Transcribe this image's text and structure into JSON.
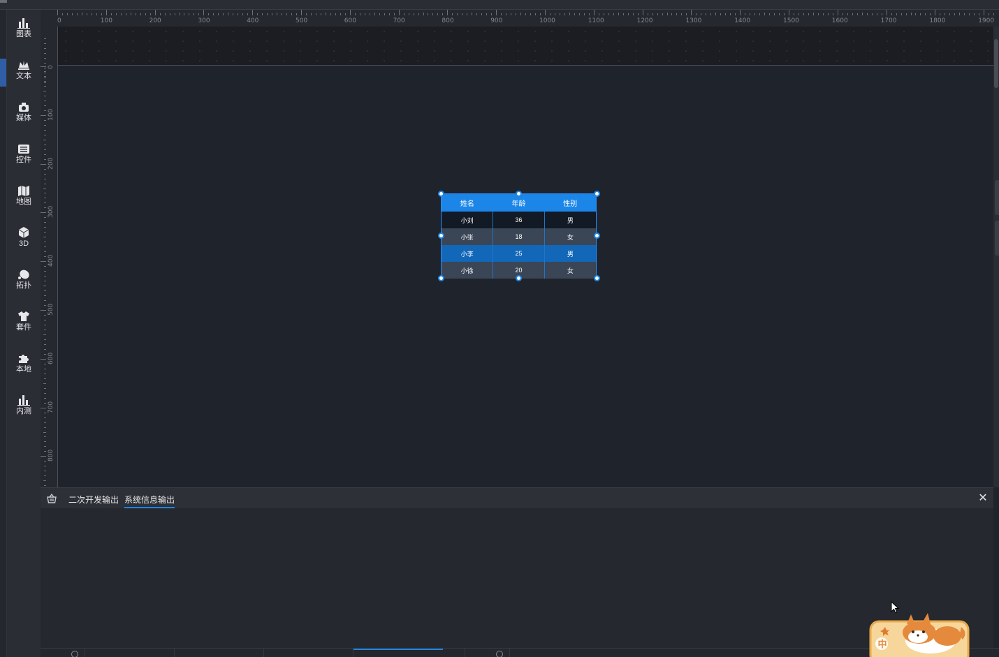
{
  "sidebar": {
    "items": [
      {
        "label": "图表",
        "icon": "bar-chart-icon"
      },
      {
        "label": "文本",
        "icon": "text-icon"
      },
      {
        "label": "媒体",
        "icon": "media-icon"
      },
      {
        "label": "控件",
        "icon": "widget-icon"
      },
      {
        "label": "地图",
        "icon": "map-icon"
      },
      {
        "label": "3D",
        "icon": "cube-icon"
      },
      {
        "label": "拓扑",
        "icon": "topology-icon"
      },
      {
        "label": "套件",
        "icon": "shirt-icon"
      },
      {
        "label": "本地",
        "icon": "puzzle-icon"
      },
      {
        "label": "内测",
        "icon": "beta-chart-icon"
      }
    ]
  },
  "ruler": {
    "top_labels": [
      "0",
      "100",
      "200",
      "300",
      "400",
      "500",
      "600",
      "700",
      "800",
      "900",
      "1000",
      "1100",
      "1200",
      "1300",
      "1400",
      "1500",
      "1600",
      "1700",
      "1800",
      "1900"
    ],
    "left_labels": [
      "0",
      "100",
      "200",
      "300",
      "400",
      "500",
      "600",
      "700",
      "800"
    ]
  },
  "table_widget": {
    "headers": [
      "姓名",
      "年龄",
      "性别"
    ],
    "rows": [
      [
        "小刘",
        "36",
        "男"
      ],
      [
        "小张",
        "18",
        "女"
      ],
      [
        "小李",
        "25",
        "男"
      ],
      [
        "小徐",
        "20",
        "女"
      ]
    ],
    "colors": {
      "header": "#1c86e8",
      "border": "#2b8cff"
    }
  },
  "output_panel": {
    "tabs": [
      "二次开发输出",
      "系统信息输出"
    ],
    "active_tab": "系统信息输出",
    "close_label": "✕"
  },
  "mascot": {
    "badge": "中"
  }
}
